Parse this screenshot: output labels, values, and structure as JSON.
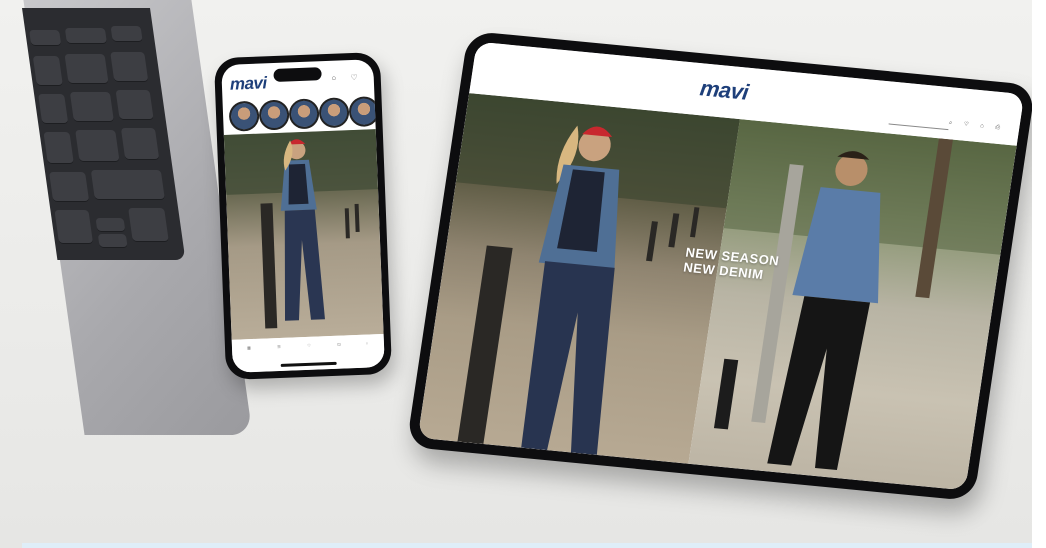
{
  "brand": {
    "logo_text": "mavi",
    "logo_color": "#1e3f7a"
  },
  "phone": {
    "header_icons": "○ ♡",
    "stories_count": 6,
    "tab_labels": [
      "",
      "",
      "",
      "",
      ""
    ]
  },
  "tablet": {
    "nav_menu": "",
    "promo_text": "",
    "search_text": "",
    "header_icons": "⌕ ♡ ⌂ ⎙",
    "hero_headline_line1": "NEW SEASON",
    "hero_headline_line2": "NEW DENIM"
  },
  "colors": {
    "background": "#ececea",
    "device_frame": "#0d0d0f",
    "bottom_strip": "#dfeef8"
  }
}
